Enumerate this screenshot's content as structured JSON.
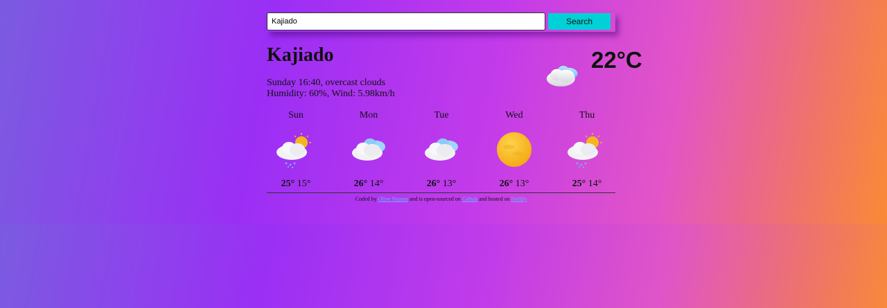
{
  "search": {
    "value": "Kajiado",
    "button_label": "Search"
  },
  "current": {
    "city": "Kajiado",
    "date_desc": "Sunday 16:40, overcast clouds",
    "humidity_wind": "Humidity: 60%, Wind: 5.98km/h",
    "temperature": "22°C",
    "icon": "cloud-icon"
  },
  "forecast": [
    {
      "day": "Sun",
      "high": "25°",
      "low": "15°",
      "icon": "sun-cloud-rain-icon"
    },
    {
      "day": "Mon",
      "high": "26°",
      "low": "14°",
      "icon": "cloud-icon"
    },
    {
      "day": "Tue",
      "high": "26°",
      "low": "13°",
      "icon": "cloud-icon"
    },
    {
      "day": "Wed",
      "high": "26°",
      "low": "13°",
      "icon": "sun-icon"
    },
    {
      "day": "Thu",
      "high": "25°",
      "low": "14°",
      "icon": "sun-cloud-rain-icon"
    }
  ],
  "footer": {
    "prefix": "Coded by",
    "author": "Olive Nzomo",
    "middle": "and is open-sourced on",
    "repo": "Github",
    "mid2": "and hosted on",
    "host": "Netlify"
  },
  "colors": {
    "button": "#00d1d6",
    "link": "#62b8ff"
  }
}
